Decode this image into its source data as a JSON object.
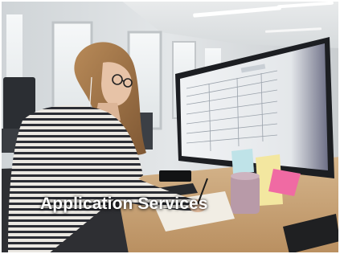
{
  "photo": {
    "subject": "woman-at-desk-with-monitor",
    "overlay_title": "Application Services",
    "colors": {
      "wall": "#d9dde0",
      "ceiling": "#e6e8ea",
      "desk": "#c8a478",
      "sweater_light": "#e8e5e0",
      "sweater_dark": "#2a2c33",
      "hair": "#a0764a",
      "monitor_frame": "#1c1e22",
      "screen": "#e9ecef",
      "sticky_pink": "#f06aa3",
      "sticky_yellow": "#f3e7a0",
      "mug": "#b89aa8"
    }
  }
}
